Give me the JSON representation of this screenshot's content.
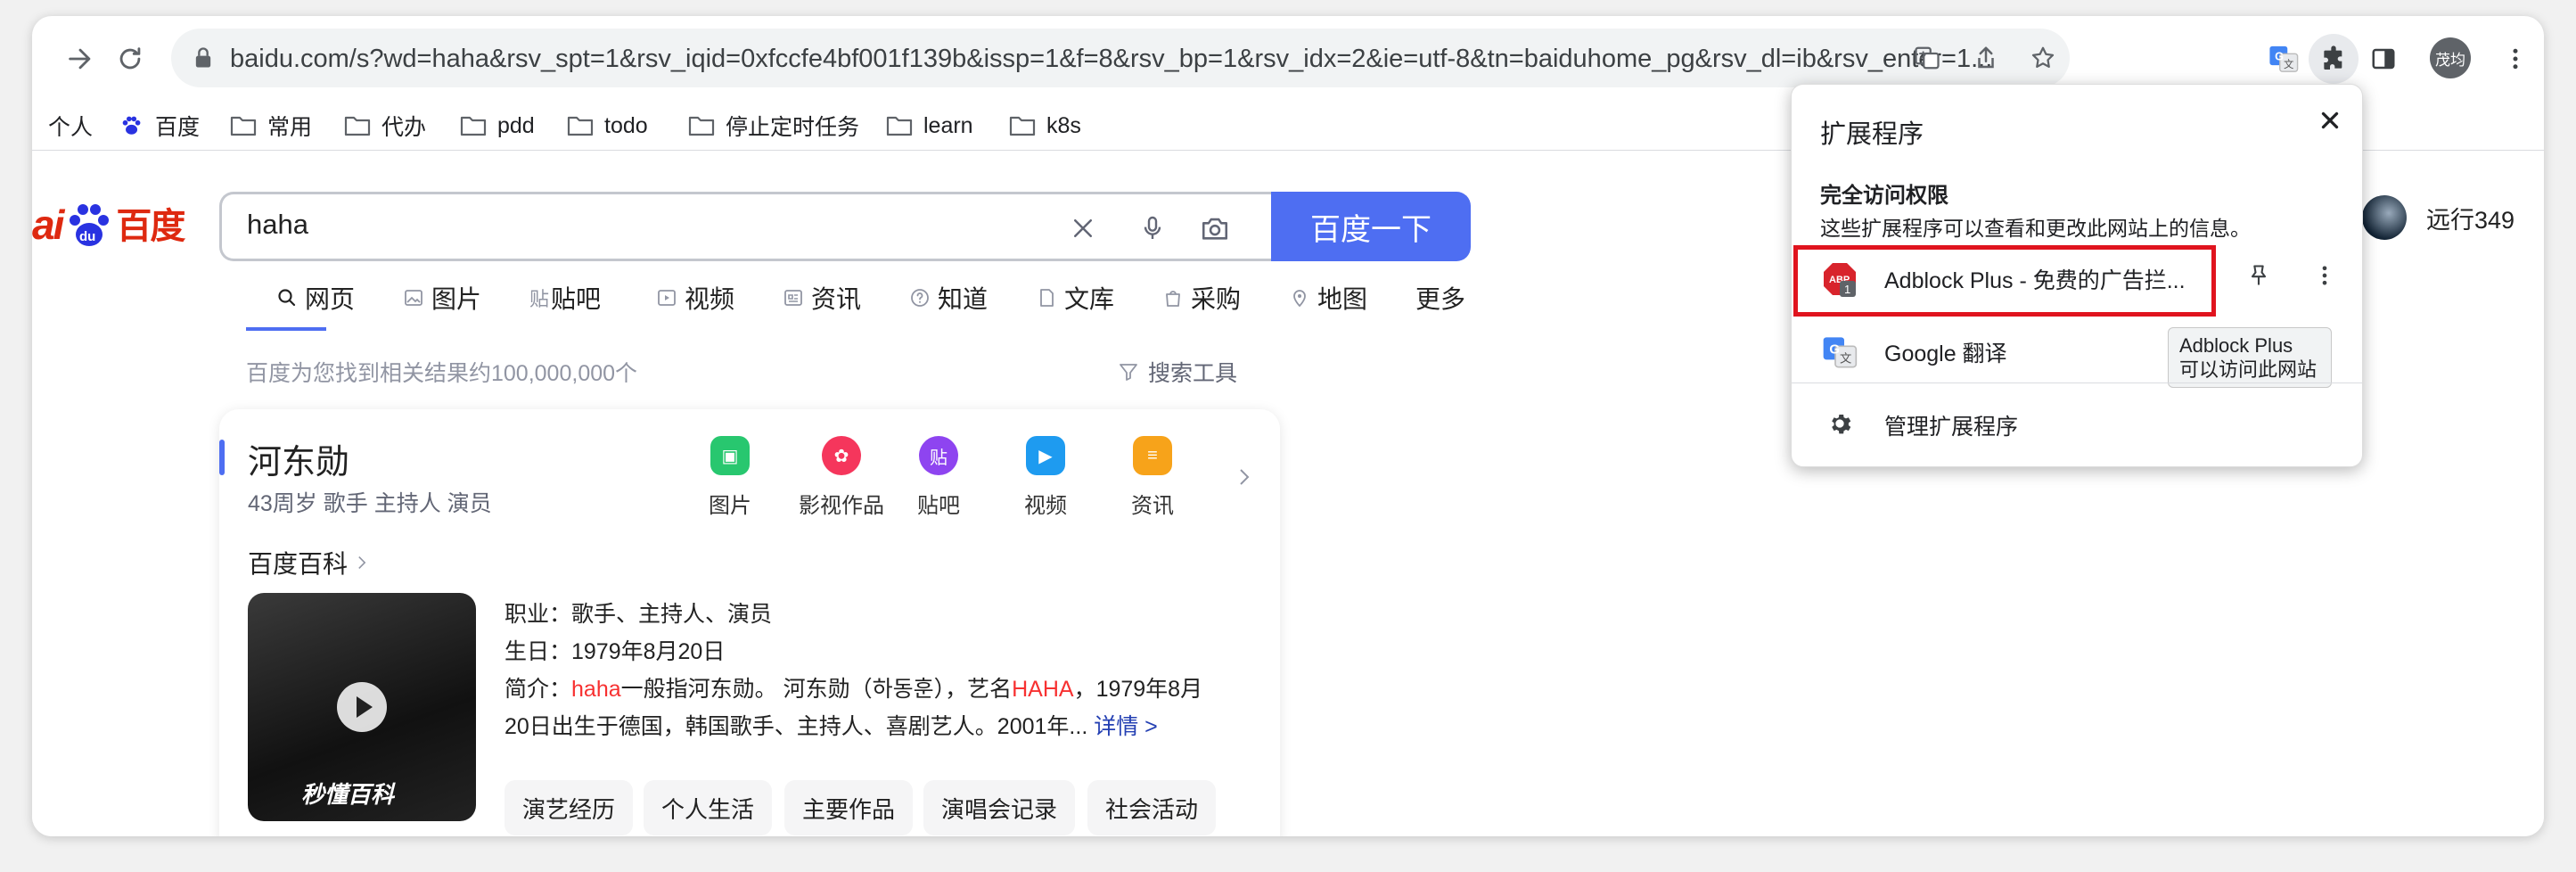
{
  "browser": {
    "url": "baidu.com/s?wd=haha&rsv_spt=1&rsv_iqid=0xfccfe4bf001f139b&issp=1&f=8&rsv_bp=1&rsv_idx=2&ie=utf-8&tn=baiduhome_pg&rsv_dl=ib&rsv_enter=1...",
    "profile_label": "茂均"
  },
  "bookmarks": [
    "个人",
    "百度",
    "常用",
    "代办",
    "pdd",
    "todo",
    "停止定时任务",
    "learn",
    "k8s"
  ],
  "search": {
    "query": "haha",
    "button_label": "百度一下"
  },
  "logo": {
    "bai": "ai",
    "du": "du",
    "cn": "百度"
  },
  "tabs": [
    "网页",
    "图片",
    "贴吧",
    "视频",
    "资讯",
    "知道",
    "文库",
    "采购",
    "地图",
    "更多"
  ],
  "results": {
    "count_text": "百度为您找到相关结果约100,000,000个",
    "tools_label": "搜索工具"
  },
  "user": {
    "name": "远行349"
  },
  "card": {
    "name": "河东勋",
    "meta": "43周岁 歌手 主持人 演员",
    "quick_links": [
      "图片",
      "影视作品",
      "贴吧",
      "视频",
      "资讯"
    ],
    "baike_label": "百度百科",
    "photo_watermark": "秒懂百科",
    "occupation": "职业：歌手、主持人、演员",
    "birthday": "生日：1979年8月20日",
    "intro_prefix": "简介：",
    "intro_kw1": "haha",
    "intro_mid": "一般指河东勋。 河东勋（하동훈），艺名",
    "intro_kw2": "HAHA",
    "intro_tail": "，1979年8月",
    "intro_line2": "20日出生于德国，韩国歌手、主持人、喜剧艺人。2001年...",
    "more_link": "详情 >",
    "chips": [
      "演艺经历",
      "个人生活",
      "主要作品",
      "演唱会记录",
      "社会活动"
    ]
  },
  "extensions_popup": {
    "title": "扩展程序",
    "section_title": "完全访问权限",
    "section_desc": "这些扩展程序可以查看和更改此网站上的信息。",
    "items": [
      {
        "name": "Adblock Plus - 免费的广告拦...",
        "badge": "1"
      },
      {
        "name": "Google 翻译"
      }
    ],
    "manage_label": "管理扩展程序",
    "tooltip_line1": "Adblock Plus",
    "tooltip_line2": "可以访问此网站"
  },
  "colors": {
    "baidu_blue": "#4e6ef2",
    "baidu_red": "#de2910",
    "highlight_red": "#e0141e",
    "keyword_red": "#f73131"
  },
  "icons": {
    "abp": "adblock-plus-icon",
    "translate": "google-translate-icon",
    "manage": "gear-icon",
    "pin": "pin-icon",
    "more": "more-vert-icon"
  }
}
